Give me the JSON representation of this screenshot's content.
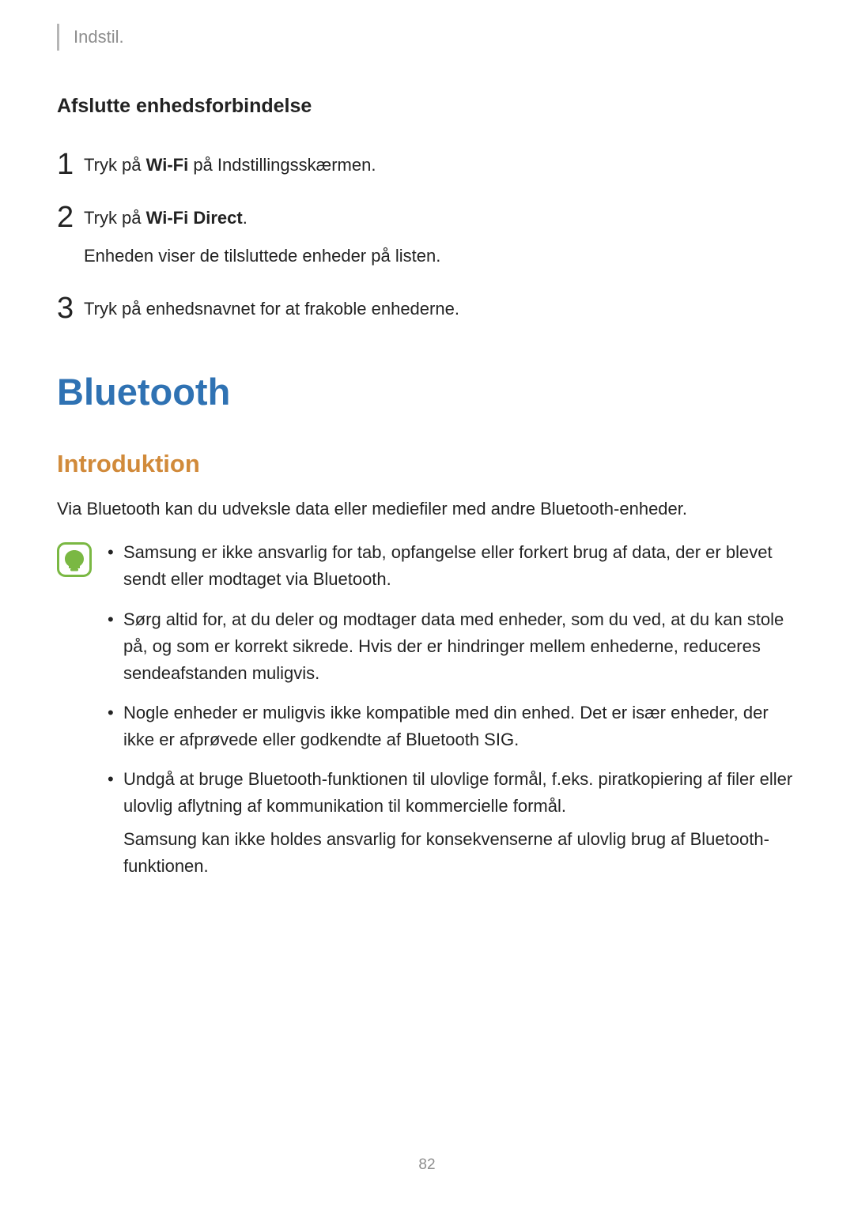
{
  "header": "Indstil.",
  "subheading": "Afslutte enhedsforbindelse",
  "steps": [
    {
      "num": "1",
      "pre": "Tryk på ",
      "bold": "Wi-Fi",
      "post": " på Indstillingsskærmen."
    },
    {
      "num": "2",
      "pre": "Tryk på ",
      "bold": "Wi-Fi Direct",
      "post": ".",
      "sub": "Enheden viser de tilsluttede enheder på listen."
    },
    {
      "num": "3",
      "pre": "",
      "bold": "",
      "post": "Tryk på enhedsnavnet for at frakoble enhederne."
    }
  ],
  "h1": "Bluetooth",
  "h2": "Introduktion",
  "intro": "Via Bluetooth kan du udveksle data eller mediefiler med andre Bluetooth-enheder.",
  "notes": [
    {
      "text": "Samsung er ikke ansvarlig for tab, opfangelse eller forkert brug af data, der er blevet sendt eller modtaget via Bluetooth."
    },
    {
      "text": "Sørg altid for, at du deler og modtager data med enheder, som du ved, at du kan stole på, og som er korrekt sikrede. Hvis der er hindringer mellem enhederne, reduceres sendeafstanden muligvis."
    },
    {
      "text": "Nogle enheder er muligvis ikke kompatible med din enhed. Det er især enheder, der ikke er afprøvede eller godkendte af Bluetooth SIG."
    },
    {
      "text": "Undgå at bruge Bluetooth-funktionen til ulovlige formål, f.eks. piratkopiering af filer eller ulovlig aflytning af kommunikation til kommercielle formål.",
      "extra": "Samsung kan ikke holdes ansvarlig for konsekvenserne af ulovlig brug af Bluetooth-funktionen."
    }
  ],
  "page_number": "82",
  "bullet": "•"
}
